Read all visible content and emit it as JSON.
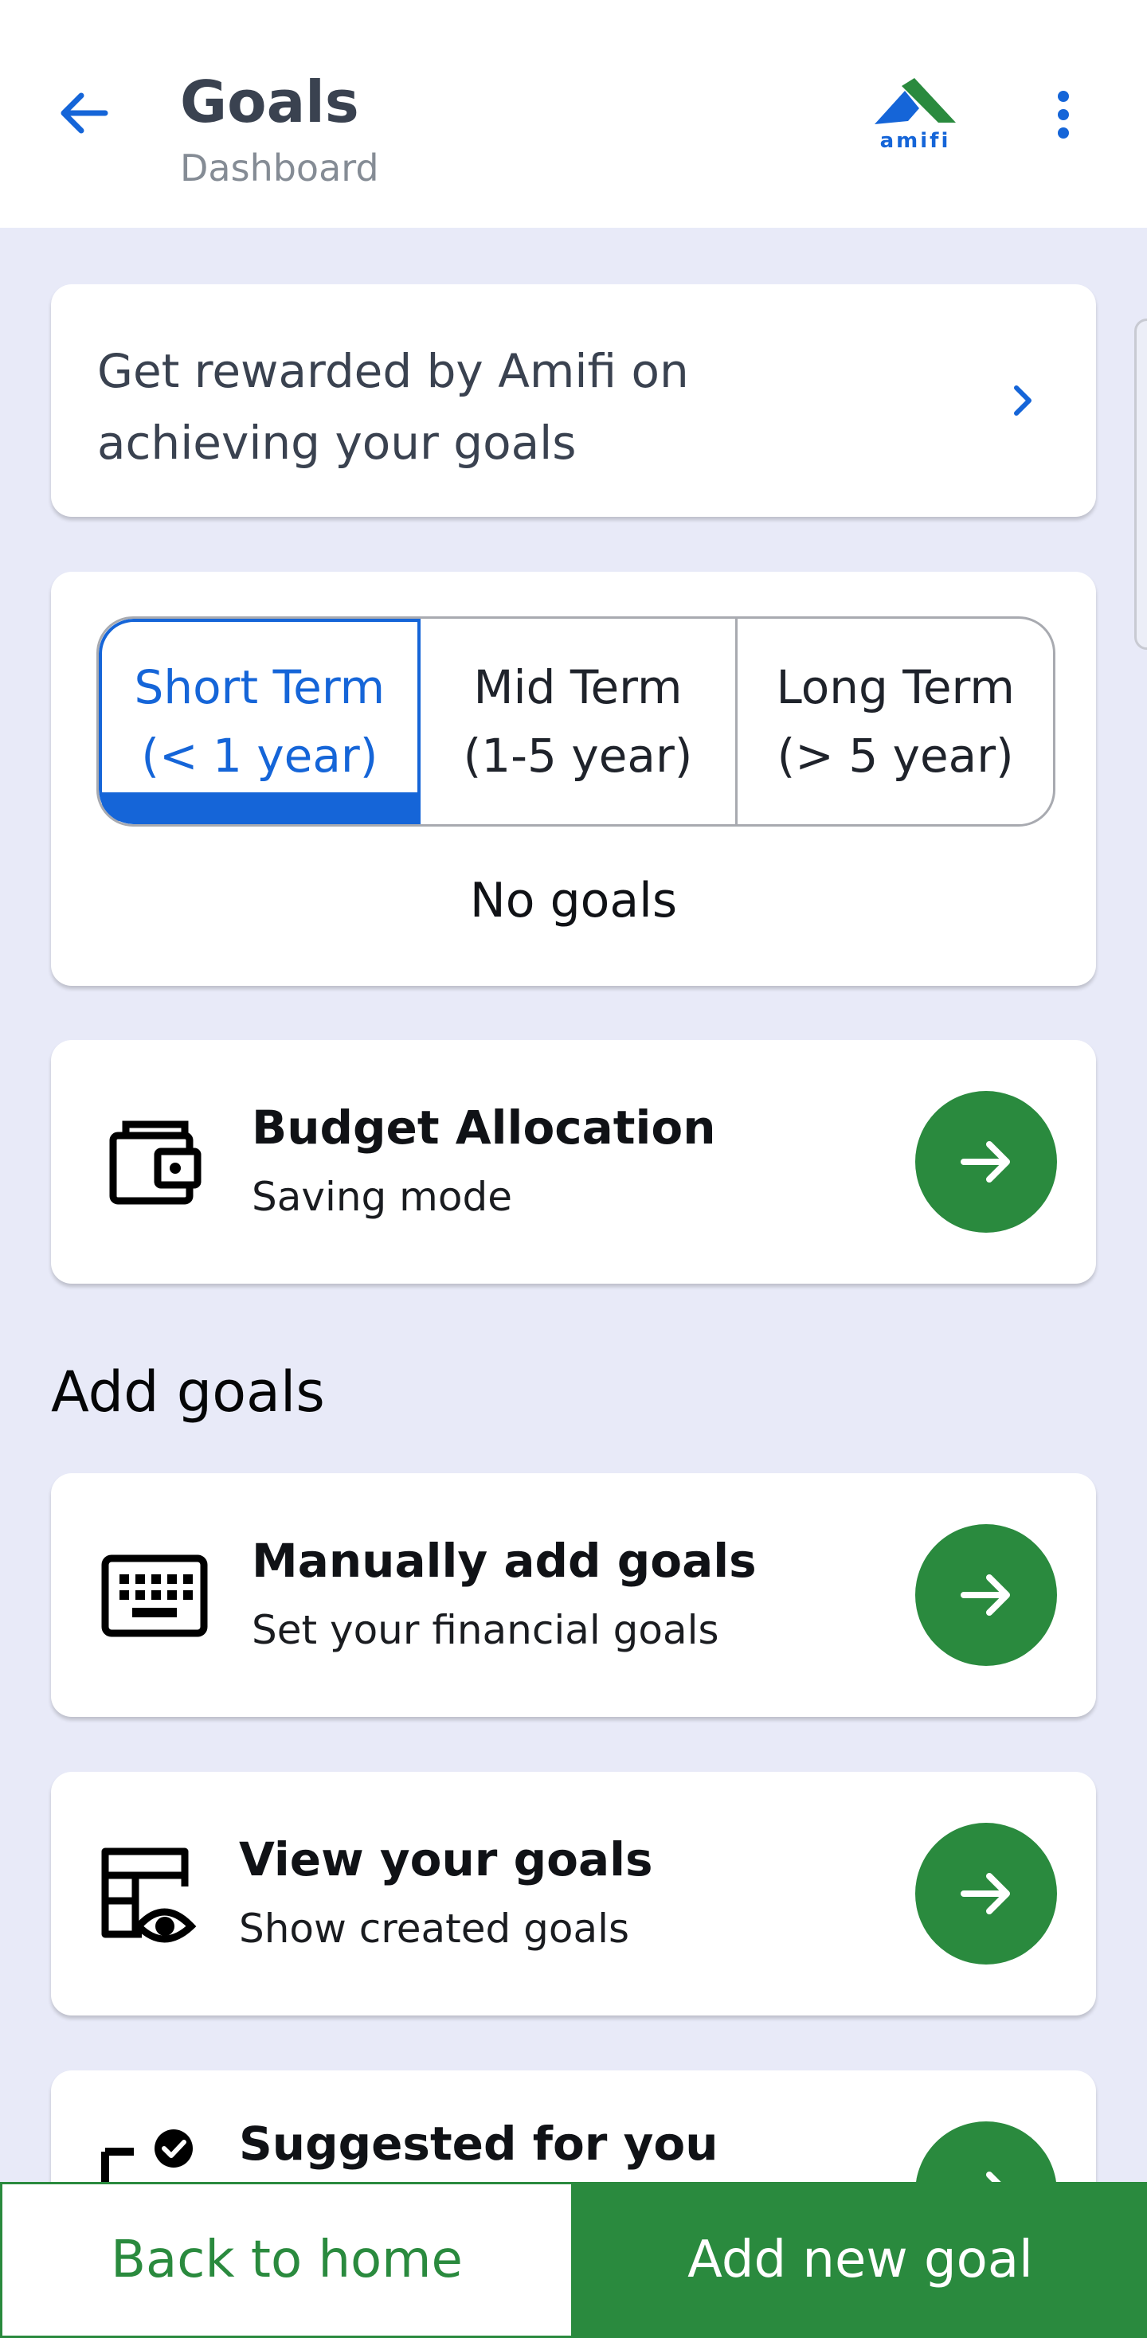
{
  "header": {
    "title": "Goals",
    "subtitle": "Dashboard",
    "logo_text": "amifi",
    "back_icon": "arrow-left-icon",
    "menu_icon": "more-vertical-icon"
  },
  "reward_banner": {
    "text": "Get rewarded by Amifi on achieving your goals",
    "icon": "chevron-right-icon"
  },
  "term_tabs": {
    "tabs": [
      {
        "label": "Short Term\n(< 1 year)",
        "selected": true
      },
      {
        "label": "Mid Term\n(1-5 year)",
        "selected": false
      },
      {
        "label": "Long Term\n(> 5 year)",
        "selected": false
      }
    ],
    "empty_text": "No goals"
  },
  "budget": {
    "title": "Budget Allocation",
    "subtitle": "Saving mode",
    "icon": "wallet-icon"
  },
  "add_goals": {
    "section_title": "Add goals",
    "items": [
      {
        "title": "Manually add goals",
        "subtitle": "Set your financial goals",
        "icon": "keyboard-icon"
      },
      {
        "title": "View your goals",
        "subtitle": "Show created goals",
        "icon": "view-table-icon"
      },
      {
        "title": "Suggested for you",
        "subtitle": "",
        "icon": "checklist-icon"
      }
    ]
  },
  "bottom_bar": {
    "back_label": "Back to home",
    "add_label": "Add new goal"
  },
  "colors": {
    "primary_blue": "#1565d8",
    "primary_green": "#2a8a3e",
    "background": "#e8eaf8"
  }
}
